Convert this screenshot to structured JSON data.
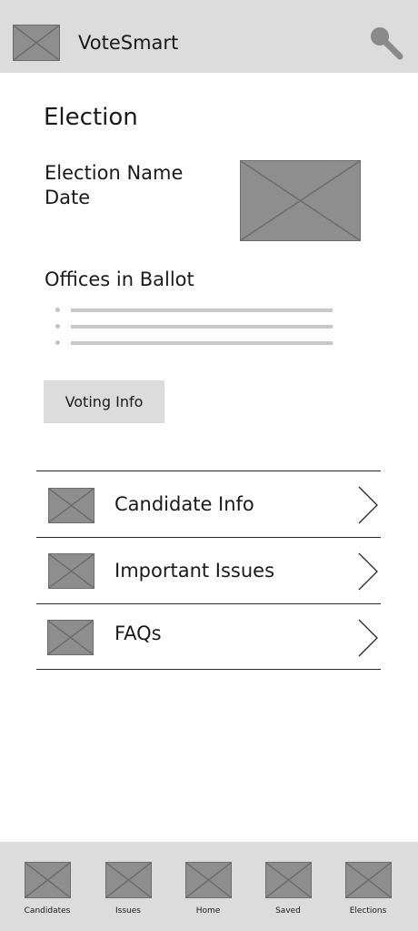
{
  "header": {
    "app_title": "VoteSmart",
    "logo_icon": "image-placeholder-icon",
    "search_icon": "search-icon"
  },
  "election": {
    "section_title": "Election",
    "name": "Election Name",
    "date": "Date",
    "image_icon": "image-placeholder-icon"
  },
  "offices": {
    "title": "Offices in Ballot",
    "item_count": 3
  },
  "voting_button": {
    "label": "Voting Info"
  },
  "nav_list": [
    {
      "label": "Candidate Info",
      "icon": "image-placeholder-icon",
      "chevron": "chevron-right-icon"
    },
    {
      "label": "Important Issues",
      "icon": "image-placeholder-icon",
      "chevron": "chevron-right-icon"
    },
    {
      "label": "FAQs",
      "icon": "image-placeholder-icon",
      "chevron": "chevron-right-icon"
    }
  ],
  "tabbar": {
    "tabs": [
      {
        "label": "Candidates",
        "icon": "image-placeholder-icon"
      },
      {
        "label": "Issues",
        "icon": "image-placeholder-icon"
      },
      {
        "label": "Home",
        "icon": "image-placeholder-icon"
      },
      {
        "label": "Saved",
        "icon": "image-placeholder-icon"
      },
      {
        "label": "Elections",
        "icon": "image-placeholder-icon"
      }
    ]
  },
  "colors": {
    "bar_background": "#dcdcdc",
    "placeholder_fill": "#8e8e8e",
    "divider": "#2a2a2a",
    "list_line": "#c8c8c8"
  }
}
